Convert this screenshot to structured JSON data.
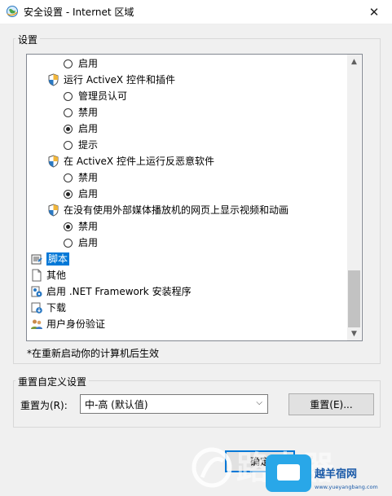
{
  "window": {
    "title": "安全设置 - Internet 区域"
  },
  "settings_group": {
    "label": "设置"
  },
  "tree": [
    {
      "kind": "radio",
      "level": 2,
      "label": "启用",
      "checked": false
    },
    {
      "kind": "setting",
      "label": "运行 ActiveX 控件和插件"
    },
    {
      "kind": "radio",
      "level": 2,
      "label": "管理员认可",
      "checked": false
    },
    {
      "kind": "radio",
      "level": 2,
      "label": "禁用",
      "checked": false
    },
    {
      "kind": "radio",
      "level": 2,
      "label": "启用",
      "checked": true
    },
    {
      "kind": "radio",
      "level": 2,
      "label": "提示",
      "checked": false
    },
    {
      "kind": "setting",
      "label": "在 ActiveX 控件上运行反恶意软件"
    },
    {
      "kind": "radio",
      "level": 2,
      "label": "禁用",
      "checked": false
    },
    {
      "kind": "radio",
      "level": 2,
      "label": "启用",
      "checked": true
    },
    {
      "kind": "setting",
      "label": "在没有使用外部媒体播放机的网页上显示视频和动画"
    },
    {
      "kind": "radio",
      "level": 2,
      "label": "禁用",
      "checked": true
    },
    {
      "kind": "radio",
      "level": 2,
      "label": "启用",
      "checked": false
    },
    {
      "kind": "category",
      "label": "脚本",
      "icon": "script-icon",
      "selected": true
    },
    {
      "kind": "category",
      "label": "其他",
      "icon": "page-icon",
      "selected": false
    },
    {
      "kind": "category",
      "label": "启用 .NET Framework 安装程序",
      "icon": "gear-page-icon",
      "selected": false
    },
    {
      "kind": "category",
      "label": "下载",
      "icon": "download-icon",
      "selected": false
    },
    {
      "kind": "category",
      "label": "用户身份验证",
      "icon": "users-icon",
      "selected": false
    }
  ],
  "note": "*在重新启动你的计算机后生效",
  "reset_group": {
    "label": "重置自定义设置",
    "reset_to_label": "重置为(R):",
    "selected_option": "中-高 (默认值)",
    "reset_button": "重置(E)..."
  },
  "footer": {
    "ok_button": "确定"
  },
  "watermark": {
    "text": "路由器",
    "site_name": "越羊宿网",
    "site_url": "www.yueyangbang.com"
  }
}
